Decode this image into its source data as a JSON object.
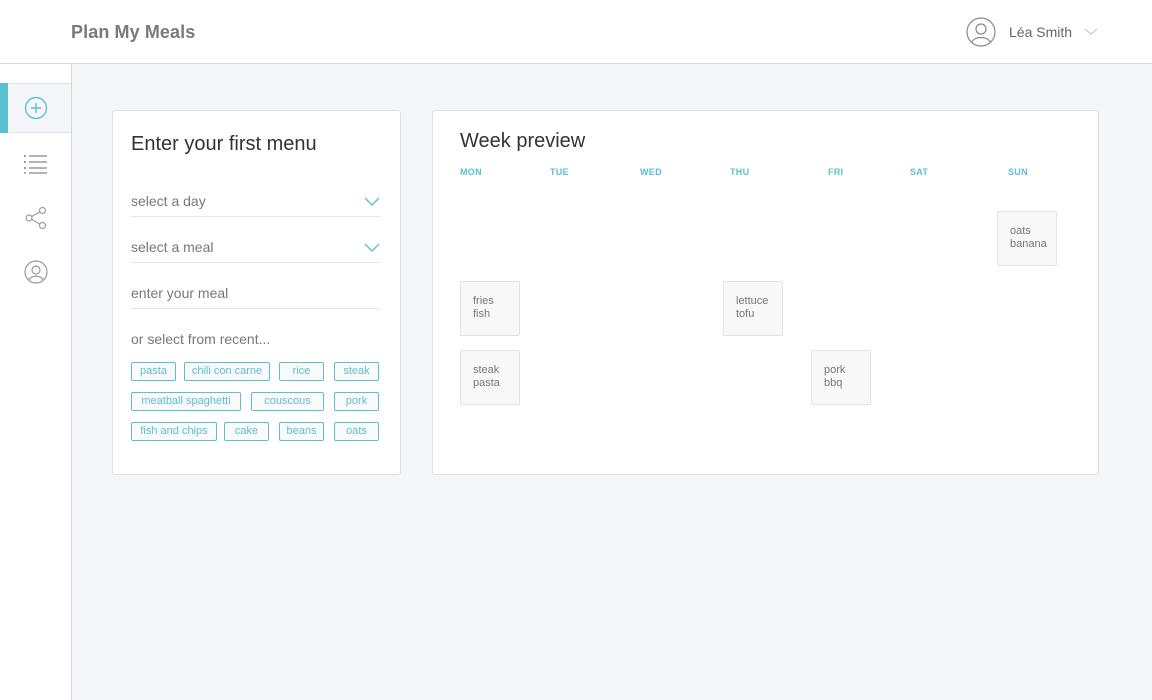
{
  "app": {
    "title": "Plan My Meals"
  },
  "user": {
    "name": "Léa Smith"
  },
  "sidebar": {
    "items": [
      {
        "name": "add",
        "icon": "plus-circle-icon",
        "active": true
      },
      {
        "name": "list",
        "icon": "list-icon",
        "active": false
      },
      {
        "name": "share",
        "icon": "share-icon",
        "active": false
      },
      {
        "name": "profile",
        "icon": "user-circle-icon",
        "active": false
      }
    ]
  },
  "menu_form": {
    "title": "Enter your first menu",
    "day_select": {
      "value": "select a day"
    },
    "meal_select": {
      "value": "select a meal"
    },
    "meal_input": {
      "placeholder": "enter your meal"
    },
    "recent_label": "or select from recent...",
    "recent_items": [
      "pasta",
      "chili con carne",
      "rice",
      "steak",
      "meatball spaghetti",
      "couscous",
      "pork",
      "fish and chips",
      "cake",
      "beans",
      "oats"
    ]
  },
  "week": {
    "title": "Week preview",
    "days": [
      "MON",
      "TUE",
      "WED",
      "THU",
      "FRI",
      "SAT",
      "SUN"
    ],
    "meals": [
      {
        "day": "SUN",
        "items": [
          "oats",
          "banana"
        ]
      },
      {
        "day": "MON",
        "items": [
          "fries",
          "fish"
        ]
      },
      {
        "day": "THU",
        "items": [
          "lettuce",
          "tofu"
        ]
      },
      {
        "day": "MON",
        "items": [
          "steak",
          "pasta"
        ]
      },
      {
        "day": "FRI",
        "items": [
          "pork",
          "bbq"
        ]
      }
    ]
  },
  "colors": {
    "accent": "#5bc0d0",
    "background": "#f5f6fa",
    "card": "#ffffff",
    "border": "#e1e1e1"
  }
}
